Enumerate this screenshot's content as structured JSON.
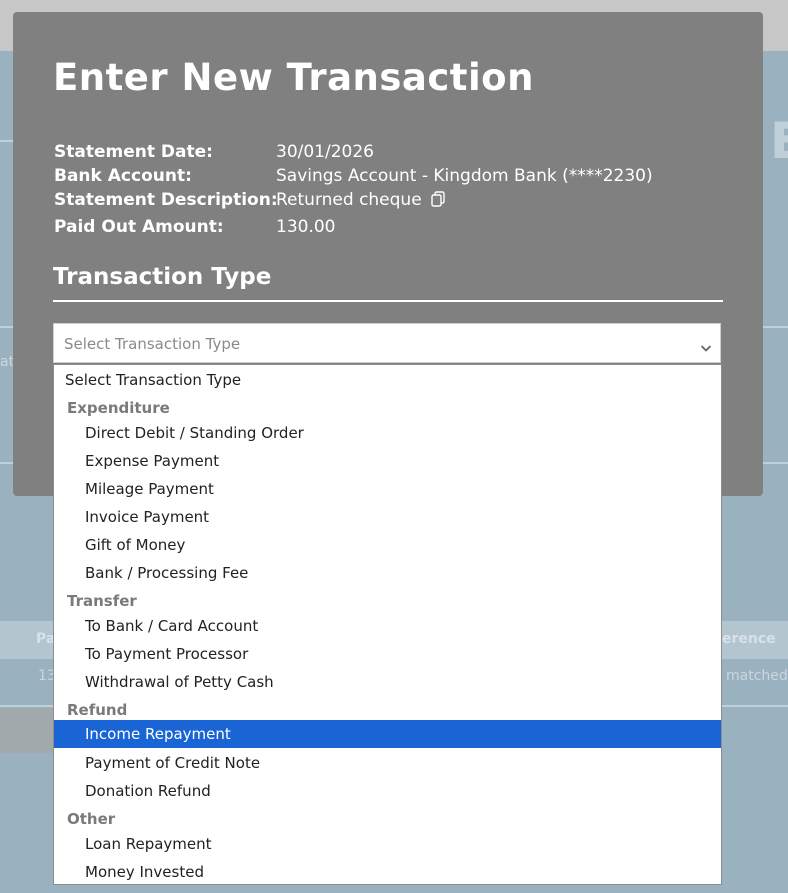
{
  "modal": {
    "title": "Enter New Transaction",
    "info": [
      {
        "label": "Statement Date:",
        "value": "30/01/2026"
      },
      {
        "label": "Bank Account:",
        "value": "Savings Account - Kingdom Bank (****2230)"
      },
      {
        "label": "Statement Description:",
        "value": "Returned cheque"
      },
      {
        "label": "Paid Out Amount:",
        "value": "130.00"
      }
    ],
    "section_title": "Transaction Type",
    "select": {
      "placeholder": "Select Transaction Type"
    },
    "dropdown": {
      "first_option": "Select Transaction Type",
      "groups": [
        {
          "label": "Expenditure",
          "options": [
            "Direct Debit / Standing Order",
            "Expense Payment",
            "Mileage Payment",
            "Invoice Payment",
            "Gift of Money",
            "Bank / Processing Fee"
          ]
        },
        {
          "label": "Transfer",
          "options": [
            "To Bank / Card Account",
            "To Payment Processor",
            "Withdrawal of Petty Cash"
          ]
        },
        {
          "label": "Refund",
          "options": [
            "Income Repayment",
            "Payment of Credit Note",
            "Donation Refund"
          ]
        },
        {
          "label": "Other",
          "options": [
            "Loan Repayment",
            "Money Invested"
          ]
        }
      ],
      "highlighted": "Income Repayment"
    }
  },
  "background": {
    "big_letter": "E",
    "side_text": "at",
    "headers": [
      "Pa",
      "erence"
    ],
    "cells": [
      "13",
      "matched"
    ]
  },
  "colors": {
    "modal_bg": "#808080",
    "highlight": "#1a65d6",
    "backdrop": "#9ab2bf"
  },
  "icons": {
    "copy": "copy-icon",
    "chevron": "chevron-down-icon"
  }
}
